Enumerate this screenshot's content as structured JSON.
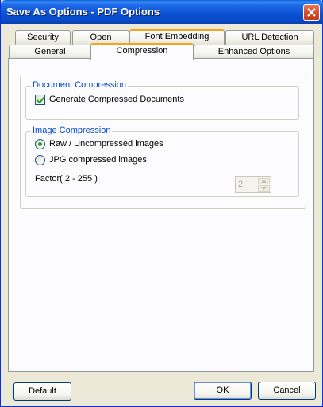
{
  "window": {
    "title": "Save As Options - PDF Options"
  },
  "tabs": {
    "row1": [
      {
        "label": "Security"
      },
      {
        "label": "Open"
      },
      {
        "label": "Font Embedding"
      },
      {
        "label": "URL Detection"
      }
    ],
    "row2": [
      {
        "label": "General"
      },
      {
        "label": "Compression",
        "selected": true
      },
      {
        "label": "Enhanced Options"
      }
    ]
  },
  "document_compression": {
    "legend": "Document Compression",
    "checkbox_label": "Generate Compressed Documents",
    "checked": true
  },
  "image_compression": {
    "legend": "Image Compression",
    "options": [
      {
        "label": "Raw / Uncompressed images",
        "selected": true
      },
      {
        "label": "JPG compressed images",
        "selected": false
      }
    ],
    "factor_label": "Factor( 2 - 255 )",
    "factor_value": "2"
  },
  "buttons": {
    "default": "Default",
    "ok": "OK",
    "cancel": "Cancel"
  },
  "colors": {
    "titlebar": "#0a50d0",
    "tab_highlight": "#f7a319",
    "legend_text": "#0046d5",
    "radio_dot": "#21a121",
    "window_bg": "#ece9d8"
  }
}
